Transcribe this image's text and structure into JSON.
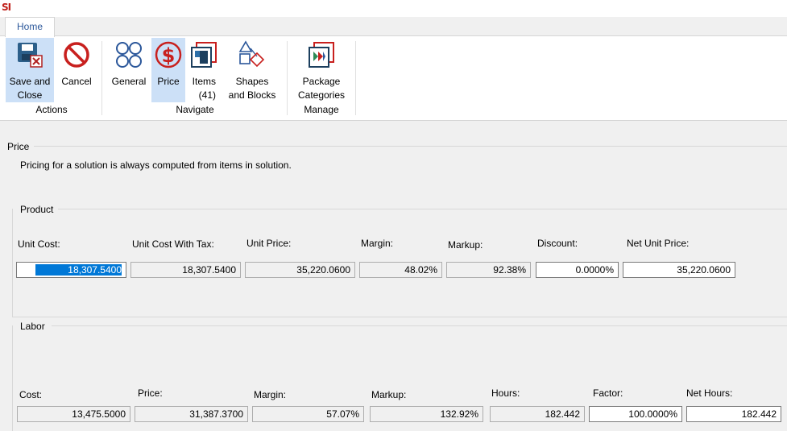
{
  "app": {
    "logo": "SI"
  },
  "ribbon": {
    "tab": "Home",
    "groups": {
      "actions": "Actions",
      "navigate": "Navigate",
      "manage": "Manage"
    },
    "buttons": {
      "save_close": "Save and\nClose",
      "cancel": "Cancel",
      "general": "General",
      "price": "Price",
      "items": "Items\n(41)",
      "shapes": "Shapes\nand Blocks",
      "package": "Package\nCategories"
    },
    "colors": {
      "accent": "#2b579a",
      "active": "#cce0f7",
      "stop_red": "#c8201e",
      "price_red": "#c8201e"
    }
  },
  "price_section": {
    "title": "Price",
    "description": "Pricing for a solution is always computed from items in solution."
  },
  "product": {
    "title": "Product",
    "labels": {
      "unit_cost": "Unit Cost:",
      "unit_cost_tax": "Unit Cost With Tax:",
      "unit_price": "Unit Price:",
      "margin": "Margin:",
      "markup": "Markup:",
      "discount": "Discount:",
      "net_unit_price": "Net Unit Price:"
    },
    "values": {
      "unit_cost": "18,307.5400",
      "unit_cost_tax": "18,307.5400",
      "unit_price": "35,220.0600",
      "margin": "48.02%",
      "markup": "92.38%",
      "discount": "0.0000%",
      "net_unit_price": "35,220.0600"
    }
  },
  "labor": {
    "title": "Labor",
    "labels": {
      "cost": "Cost:",
      "price": "Price:",
      "margin": "Margin:",
      "markup": "Markup:",
      "hours": "Hours:",
      "factor": "Factor:",
      "net_hours": "Net Hours:"
    },
    "values": {
      "cost": "13,475.5000",
      "price": "31,387.3700",
      "margin": "57.07%",
      "markup": "132.92%",
      "hours": "182.442",
      "factor": "100.0000%",
      "net_hours": "182.442"
    }
  }
}
